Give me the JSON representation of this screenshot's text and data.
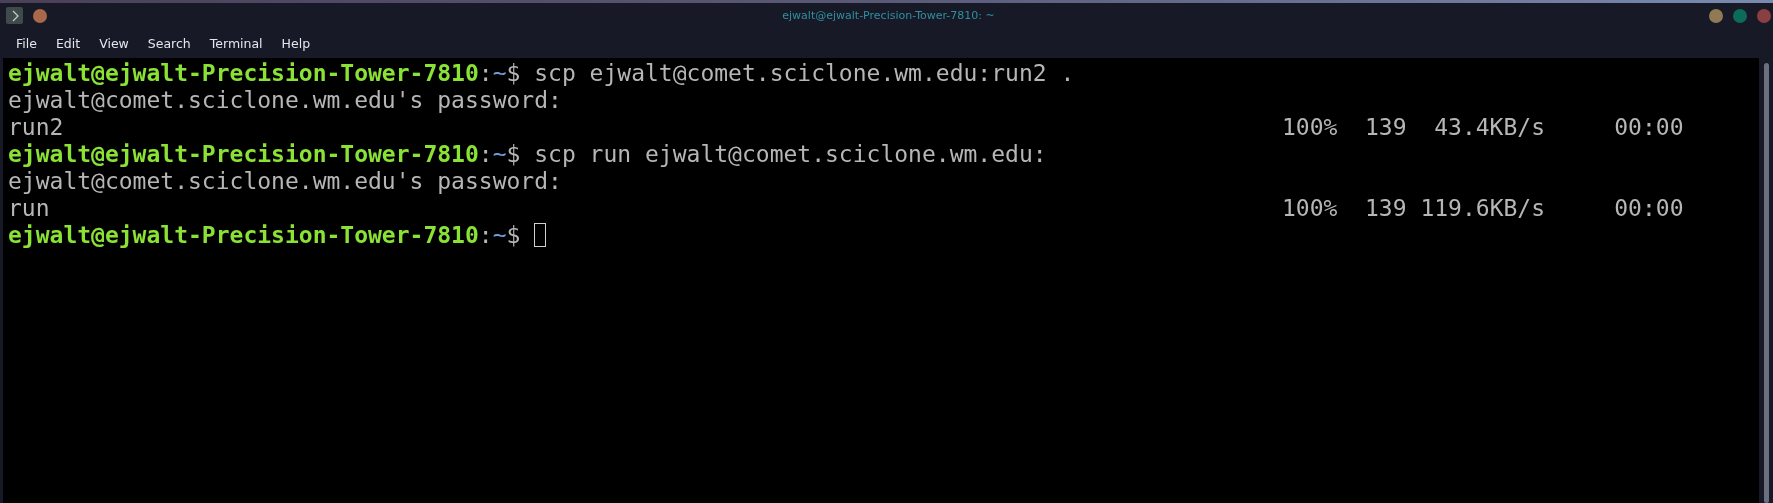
{
  "window": {
    "title": "ejwalt@ejwalt-Precision-Tower-7810: ~"
  },
  "menu": [
    "File",
    "Edit",
    "View",
    "Search",
    "Terminal",
    "Help"
  ],
  "terminal": {
    "lines": [
      {
        "kind": "command",
        "prompt": {
          "user_host": "ejwalt@ejwalt-Precision-Tower-7810",
          "separator": ":",
          "path": "~",
          "symbol": "$"
        },
        "command": "scp ejwalt@comet.sciclone.wm.edu:run2 .",
        "cursor": false
      },
      {
        "kind": "text",
        "text": "ejwalt@comet.sciclone.wm.edu's password:"
      },
      {
        "kind": "progress",
        "file": "run2",
        "percent": "100%",
        "size": "139",
        "rate": "43.4KB/s",
        "eta": "00:00"
      },
      {
        "kind": "command",
        "prompt": {
          "user_host": "ejwalt@ejwalt-Precision-Tower-7810",
          "separator": ":",
          "path": "~",
          "symbol": "$"
        },
        "command": "scp run ejwalt@comet.sciclone.wm.edu:",
        "cursor": false
      },
      {
        "kind": "text",
        "text": "ejwalt@comet.sciclone.wm.edu's password:"
      },
      {
        "kind": "progress",
        "file": "run",
        "percent": "100%",
        "size": "139",
        "rate": "119.6KB/s",
        "eta": "00:00"
      },
      {
        "kind": "command",
        "prompt": {
          "user_host": "ejwalt@ejwalt-Precision-Tower-7810",
          "separator": ":",
          "path": "~",
          "symbol": "$"
        },
        "cursor": true
      }
    ]
  }
}
